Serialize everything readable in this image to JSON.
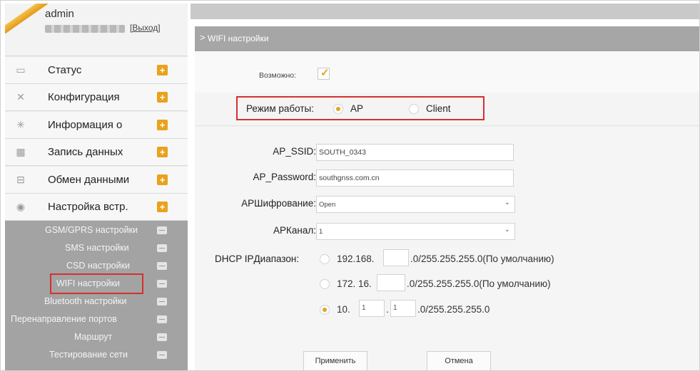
{
  "user": {
    "name": "admin",
    "logout": "[Выход]"
  },
  "menu": [
    {
      "icon": "monitor-icon",
      "label": "Статус"
    },
    {
      "icon": "tools-icon",
      "label": "Конфигурация"
    },
    {
      "icon": "star-icon",
      "label": "Информация о"
    },
    {
      "icon": "calendar-icon",
      "label": "Запись данных"
    },
    {
      "icon": "exchange-icon",
      "label": "Обмен данными"
    },
    {
      "icon": "gear-icon",
      "label": "Настройка встр."
    }
  ],
  "submenu": [
    {
      "label": "GSM/GPRS настройки"
    },
    {
      "label": "SMS настройки"
    },
    {
      "label": "CSD настройки"
    },
    {
      "label": "WIFI настройки",
      "selected": true
    },
    {
      "label": "Bluetooth настройки"
    },
    {
      "label": "Перенаправление портов"
    },
    {
      "label": "Маршрут"
    },
    {
      "label": "Тестирование сети"
    }
  ],
  "page": {
    "title": "WIFI настройки"
  },
  "enable": {
    "label": "Возможно:",
    "checked": true
  },
  "mode": {
    "label": "Режим работы:",
    "options": [
      "AP",
      "Client"
    ],
    "selected": "AP"
  },
  "form": {
    "ssid": {
      "label": "AP_SSID:",
      "value": "SOUTH_0343"
    },
    "password": {
      "label": "AP_Password:",
      "value": "southgnss.com.cn"
    },
    "encryption": {
      "label": "APШифрование:",
      "value": "Open"
    },
    "channel": {
      "label": "APКанал:",
      "value": "1"
    },
    "dhcp": {
      "label": "DHCP IPДиапазон:",
      "opt1": {
        "prefix": "192.168.",
        "octet": "",
        "suffix": ".0/255.255.255.0(По умолчанию)"
      },
      "opt2": {
        "prefix": "172. 16.",
        "octet": "",
        "suffix": ".0/255.255.255.0(По умолчанию)"
      },
      "opt3": {
        "prefix": "10.",
        "octet1": "1",
        "octet2": "1",
        "suffix": ".0/255.255.255.0"
      },
      "selected": 3
    }
  },
  "buttons": {
    "apply": "Применить",
    "cancel": "Отмена"
  },
  "colors": {
    "accent": "#e8a21c",
    "highlight": "#d62f2f",
    "submenu_bg": "#a3a3a3",
    "header_bg": "#a6a6a6"
  }
}
